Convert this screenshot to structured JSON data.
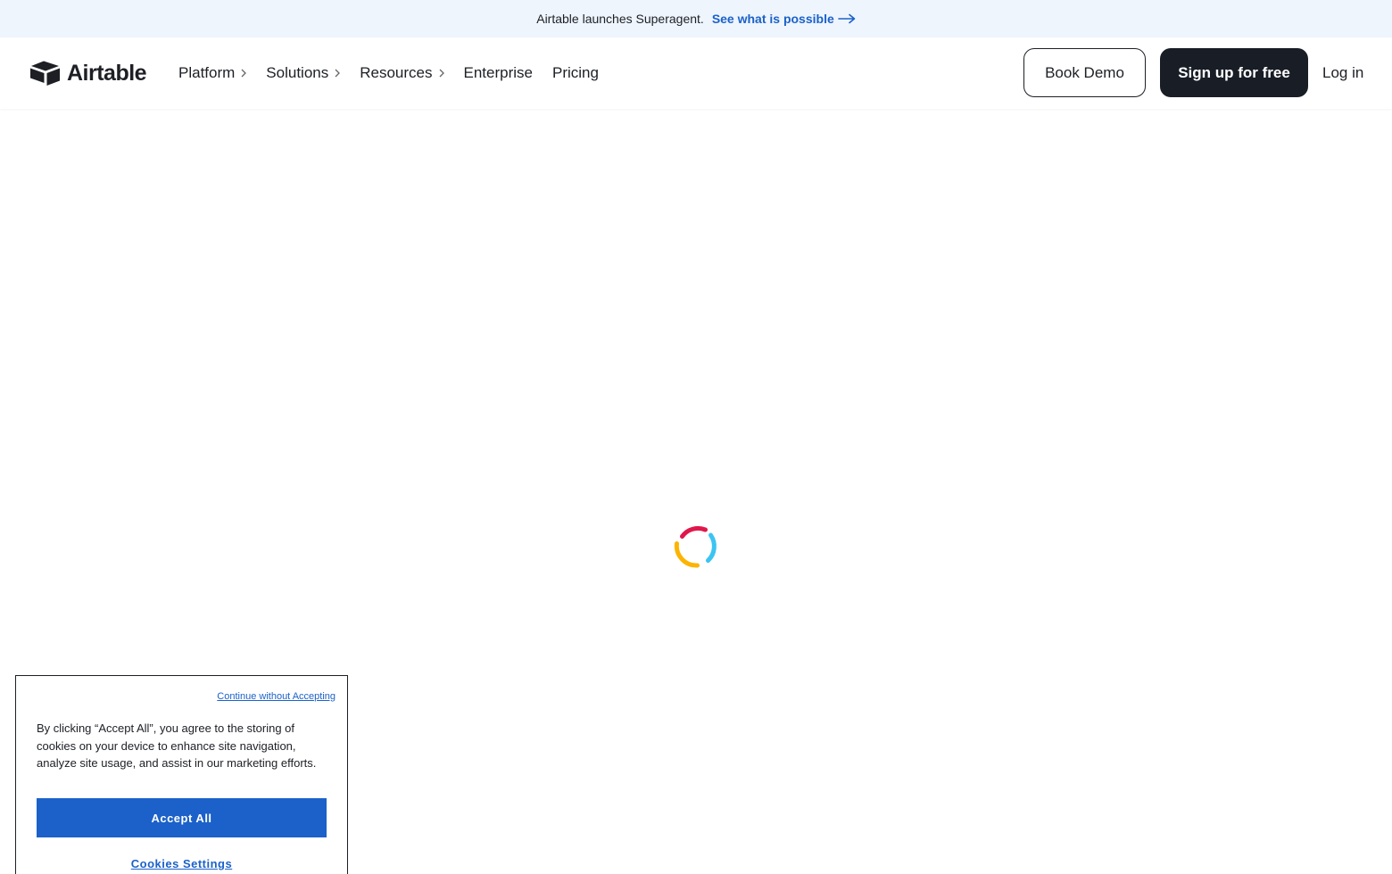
{
  "banner": {
    "text": "Airtable launches Superagent.",
    "link_label": "See what is possible",
    "link_icon": "arrow-right-icon",
    "link_color": "#1b61c9",
    "background": "#eef5fd"
  },
  "header": {
    "logo_text": "Airtable",
    "logo_icon": "airtable-logo-icon",
    "nav": [
      {
        "label": "Platform",
        "has_chevron": true
      },
      {
        "label": "Solutions",
        "has_chevron": true
      },
      {
        "label": "Resources",
        "has_chevron": true
      },
      {
        "label": "Enterprise",
        "has_chevron": false
      },
      {
        "label": "Pricing",
        "has_chevron": false
      }
    ],
    "book_demo_label": "Book Demo",
    "signup_label": "Sign up for free",
    "login_label": "Log in",
    "signup_bg": "#181d26"
  },
  "loading": {
    "icon": "loading-spinner-icon",
    "colors": [
      "#e0174b",
      "#3cc4f2",
      "#fcb400"
    ]
  },
  "cookie_banner": {
    "continue_label": "Continue without Accepting",
    "text": "By clicking “Accept All”, you agree to the storing of cookies on your device to enhance site navigation, analyze site usage, and assist in our marketing efforts.",
    "accept_label": "Accept All",
    "settings_label": "Cookies Settings",
    "accent": "#1b61c9"
  }
}
